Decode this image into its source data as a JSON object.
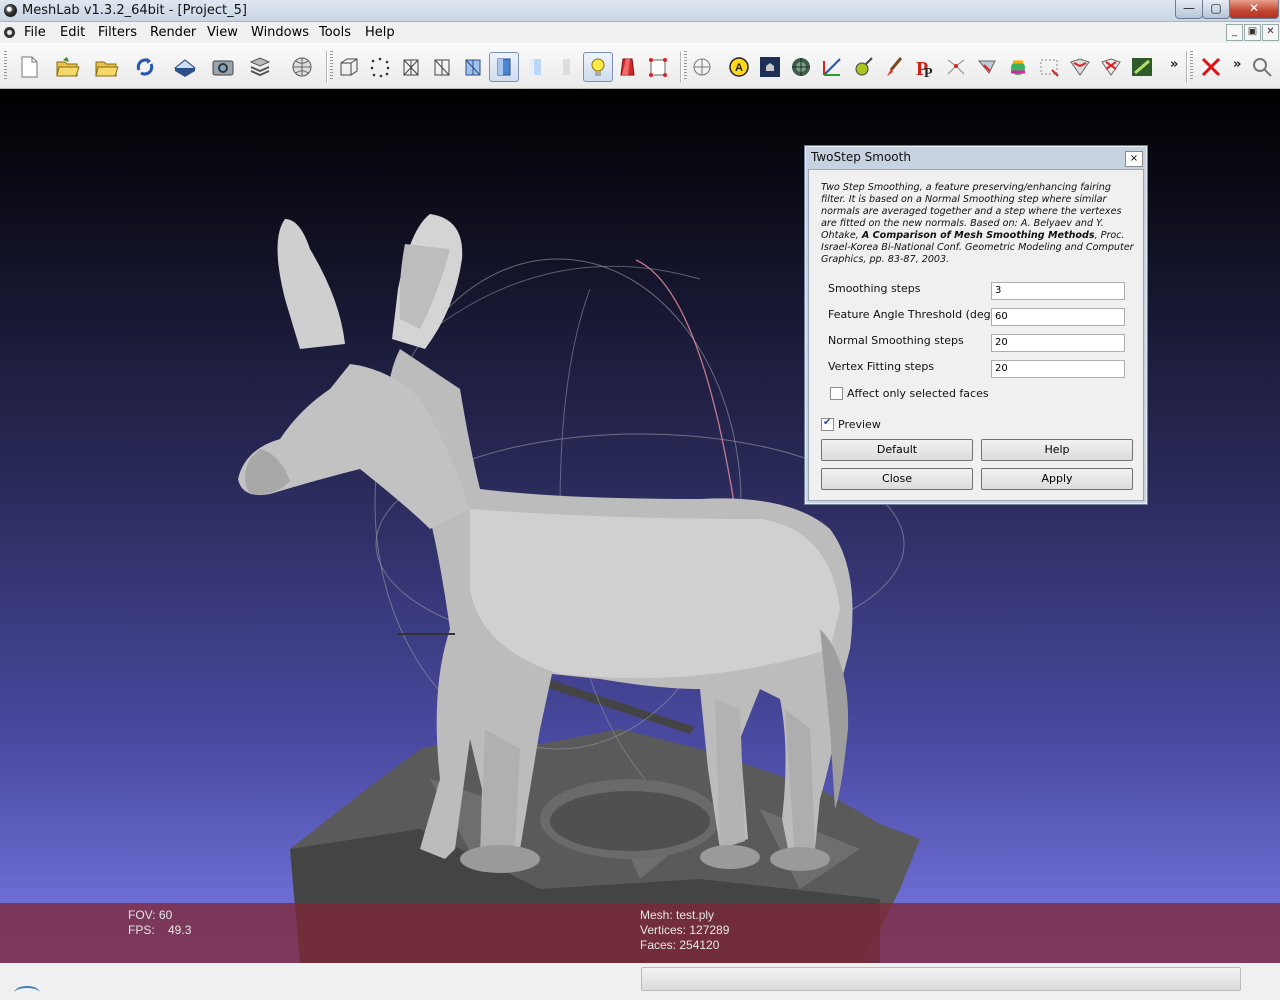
{
  "window": {
    "title": "MeshLab v1.3.2_64bit - [Project_5]",
    "min_label": "—",
    "max_label": "▢",
    "close_label": "✕"
  },
  "menu": {
    "items": [
      "File",
      "Edit",
      "Filters",
      "Render",
      "View",
      "Windows",
      "Tools",
      "Help"
    ],
    "mdi_min": "_",
    "mdi_restore": "▣",
    "mdi_close": "✕"
  },
  "toolbar": {
    "overflow_label": "»",
    "icons": [
      "new-project-icon",
      "open-project-icon",
      "open-mesh-icon",
      "reload-icon",
      "save-icon",
      "snapshot-icon",
      "layers-icon",
      "raster-icon",
      "bounding-box-icon",
      "points-icon",
      "wireframe-icon",
      "hidden-lines-icon",
      "flat-lines-icon",
      "flat-icon",
      "smooth-icon",
      "color-icon",
      "light-icon",
      "double-light-icon",
      "fancy-light-icon",
      "manipulator-icon",
      "annotation-icon",
      "texture-icon",
      "align-icon",
      "measure-icon",
      "pick-points-icon",
      "paint-icon",
      "p-icon",
      "select-vertices-icon",
      "select-faces-icon",
      "zippering-icon",
      "shaping-icon",
      "select-region-icon",
      "edit-icon",
      "edit-map-icon",
      "quality-icon",
      "delete-icon",
      "search-icon"
    ]
  },
  "viewport": {
    "fov_label": "FOV: 60",
    "fps_label": "FPS:    49.3",
    "mesh_label": "Mesh: test.ply",
    "vertices_label": "Vertices: 127289",
    "faces_label": "Faces: 254120"
  },
  "dialog": {
    "title": "TwoStep Smooth",
    "close_label": "×",
    "desc_part1": "Two Step Smoothing, a feature preserving/enhancing fairing filter. It is based on a Normal Smoothing step where similar normals are averaged together and a step where the vertexes are fitted on the new normals. Based on: A. Belyaev and Y. Ohtake, ",
    "desc_bold": "A Comparison of Mesh Smoothing Methods",
    "desc_part2": ", Proc. Israel-Korea Bi-National Conf. Geometric Modeling and Computer Graphics, pp. 83-87, 2003.",
    "params": [
      {
        "label": "Smoothing steps",
        "value": "3"
      },
      {
        "label": "Feature Angle Threshold (deg)",
        "value": "60"
      },
      {
        "label": "Normal Smoothing steps",
        "value": "20"
      },
      {
        "label": "Vertex Fitting steps",
        "value": "20"
      }
    ],
    "affect_selected_label": "Affect only selected faces",
    "affect_selected_checked": false,
    "preview_label": "Preview",
    "preview_checked": true,
    "buttons": {
      "default": "Default",
      "help": "Help",
      "close": "Close",
      "apply": "Apply"
    }
  }
}
